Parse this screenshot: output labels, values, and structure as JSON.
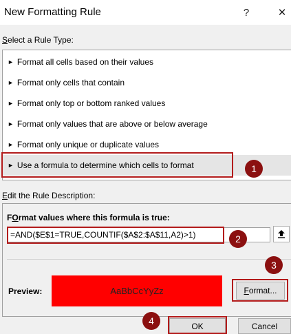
{
  "window": {
    "title": "New Formatting Rule",
    "help_glyph": "?",
    "close_glyph": "✕"
  },
  "rule_type": {
    "label_underlined": "S",
    "label_rest": "elect a Rule Type:",
    "items": [
      {
        "label": "Format all cells based on their values"
      },
      {
        "label": "Format only cells that contain"
      },
      {
        "label": "Format only top or bottom ranked values"
      },
      {
        "label": "Format only values that are above or below average"
      },
      {
        "label": "Format only unique or duplicate values"
      },
      {
        "label": "Use a formula to determine which cells to format"
      }
    ],
    "selected_index": 5,
    "arrow_glyph": "►"
  },
  "description": {
    "label_underlined": "E",
    "label_rest": "dit the Rule Description:",
    "formula_heading_underlined": "O",
    "formula_heading_prefix": "F",
    "formula_heading_rest": "rmat values where this formula is true:",
    "formula_value": "=AND($E$1=TRUE,COUNTIF($A$2:$A$11,A2)>1)",
    "preview_label": "Preview:",
    "preview_text": "AaBbCcYyZz",
    "preview_fill": "#ff0000",
    "format_button_underlined": "F",
    "format_button_rest": "ormat..."
  },
  "buttons": {
    "ok": "OK",
    "cancel": "Cancel"
  },
  "callouts": [
    "1",
    "2",
    "3",
    "4"
  ],
  "colors": {
    "highlight": "#b31b1b",
    "badge": "#8b1010"
  }
}
